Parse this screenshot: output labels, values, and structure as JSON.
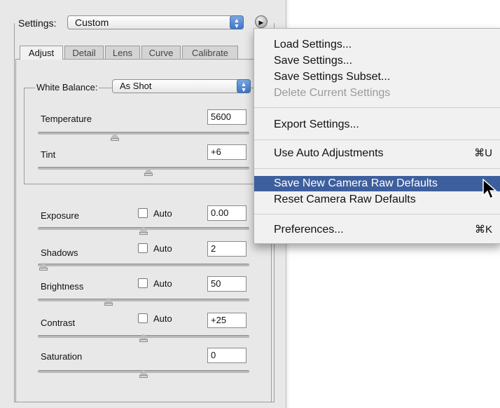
{
  "settings": {
    "label": "Settings:",
    "value": "Custom"
  },
  "tabs": [
    {
      "label": "Adjust",
      "active": true
    },
    {
      "label": "Detail"
    },
    {
      "label": "Lens"
    },
    {
      "label": "Curve"
    },
    {
      "label": "Calibrate"
    }
  ],
  "white_balance": {
    "label": "White Balance:",
    "value": "As Shot"
  },
  "sliders": {
    "temperature": {
      "label": "Temperature",
      "value": "5600"
    },
    "tint": {
      "label": "Tint",
      "value": "+6"
    },
    "exposure": {
      "label": "Exposure",
      "auto": "Auto",
      "value": "0.00"
    },
    "shadows": {
      "label": "Shadows",
      "auto": "Auto",
      "value": "2"
    },
    "brightness": {
      "label": "Brightness",
      "auto": "Auto",
      "value": "50"
    },
    "contrast": {
      "label": "Contrast",
      "auto": "Auto",
      "value": "+25"
    },
    "saturation": {
      "label": "Saturation",
      "value": "0"
    }
  },
  "menu": {
    "items": [
      {
        "label": "Load Settings..."
      },
      {
        "label": "Save Settings..."
      },
      {
        "label": "Save Settings Subset..."
      },
      {
        "label": "Delete Current Settings",
        "disabled": true
      },
      {
        "label": "Export Settings..."
      },
      {
        "label": "Use Auto Adjustments",
        "shortcut": "⌘U"
      },
      {
        "label": "Save New Camera Raw Defaults",
        "highlighted": true
      },
      {
        "label": "Reset Camera Raw Defaults"
      },
      {
        "label": "Preferences...",
        "shortcut": "⌘K"
      }
    ]
  },
  "colors": {
    "highlight": "#3d5f9d",
    "panel": "#e8e8e8",
    "menu": "#f1f1f1"
  },
  "icons": {
    "popup_arrows": "up-down-arrows-icon",
    "flyout": "flyout-menu-icon",
    "cursor": "mouse-pointer-icon"
  }
}
